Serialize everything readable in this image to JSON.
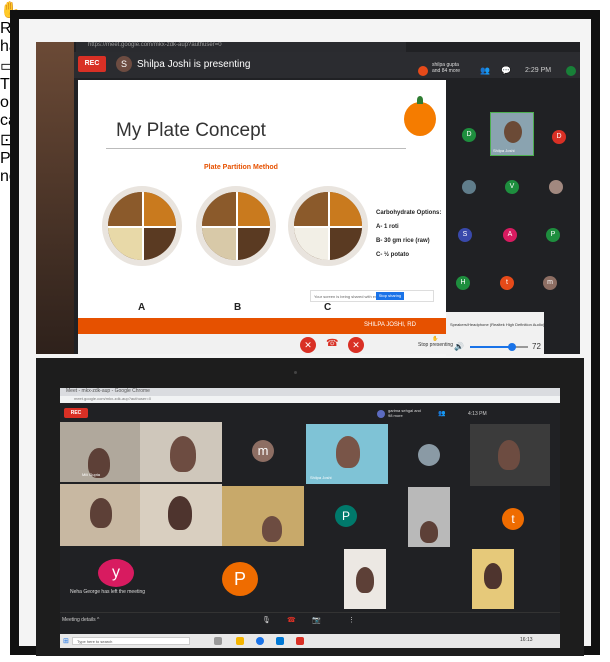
{
  "photo1": {
    "url": "https://meet.google.com/mkx-zdk-aup?authuser=0",
    "rec_label": "REC",
    "presenter_initial": "S",
    "presenting_text": "Shilpa Joshi is presenting",
    "participants_text": "shilpa gupta and 84 more",
    "clock": "2:29 PM",
    "slide": {
      "title": "My Plate Concept",
      "subtitle": "Plate Partition Method",
      "options_title": "Carbohydrate Options:",
      "options": [
        "A- 1 roti",
        "B- 30 gm rice (raw)",
        "C- ½ potato"
      ],
      "labels": [
        "A",
        "B",
        "C"
      ],
      "popup_text": "Your screen is being shared with everyone",
      "popup_button": "Stop sharing",
      "footer": "SHILPA JOSHI, RD"
    },
    "side_initials": [
      "D",
      "D",
      "V",
      "S",
      "A",
      "P",
      "H",
      "t",
      "m"
    ],
    "side_colors": [
      "#1e8e3e",
      "#d93025",
      "#1e8e3e",
      "#3949ab",
      "#d81b60",
      "#1e8e3e",
      "#1e8e3e",
      "#e64a19",
      "#8d6e63"
    ],
    "video_tile_name": "Shilpa Joshi",
    "speaker_text": "Speakers/Headphone (Realtek High Definition Audio)",
    "volume": 72,
    "present_label": "Stop presenting"
  },
  "photo2": {
    "tab_title": "Meet - mkx-zdk-aup - Google Chrome",
    "url": "meet.google.com/mkx-zdk-aup?authuser=0",
    "rec_label": "REC",
    "participants_text": "garima sehgal and 98 more",
    "clock": "4:13 PM",
    "tile_names": [
      "Mili Gupta",
      "Shilpa Joshi"
    ],
    "avatars": [
      {
        "letter": "m",
        "color": "#8d6e63"
      },
      {
        "letter": "P",
        "color": "#00796b"
      },
      {
        "letter": "t",
        "color": "#ef6c00"
      },
      {
        "letter": "y",
        "color": "#d81b60"
      },
      {
        "letter": "P",
        "color": "#ef6c00"
      }
    ],
    "left_message": "Neha George has left the meeting",
    "meeting_details": "Meeting details",
    "bottom_labels": [
      "Raise hand",
      "Turn on captions",
      "Present now"
    ],
    "taskbar_search": "Type here to search",
    "taskbar_time": "16:13"
  }
}
